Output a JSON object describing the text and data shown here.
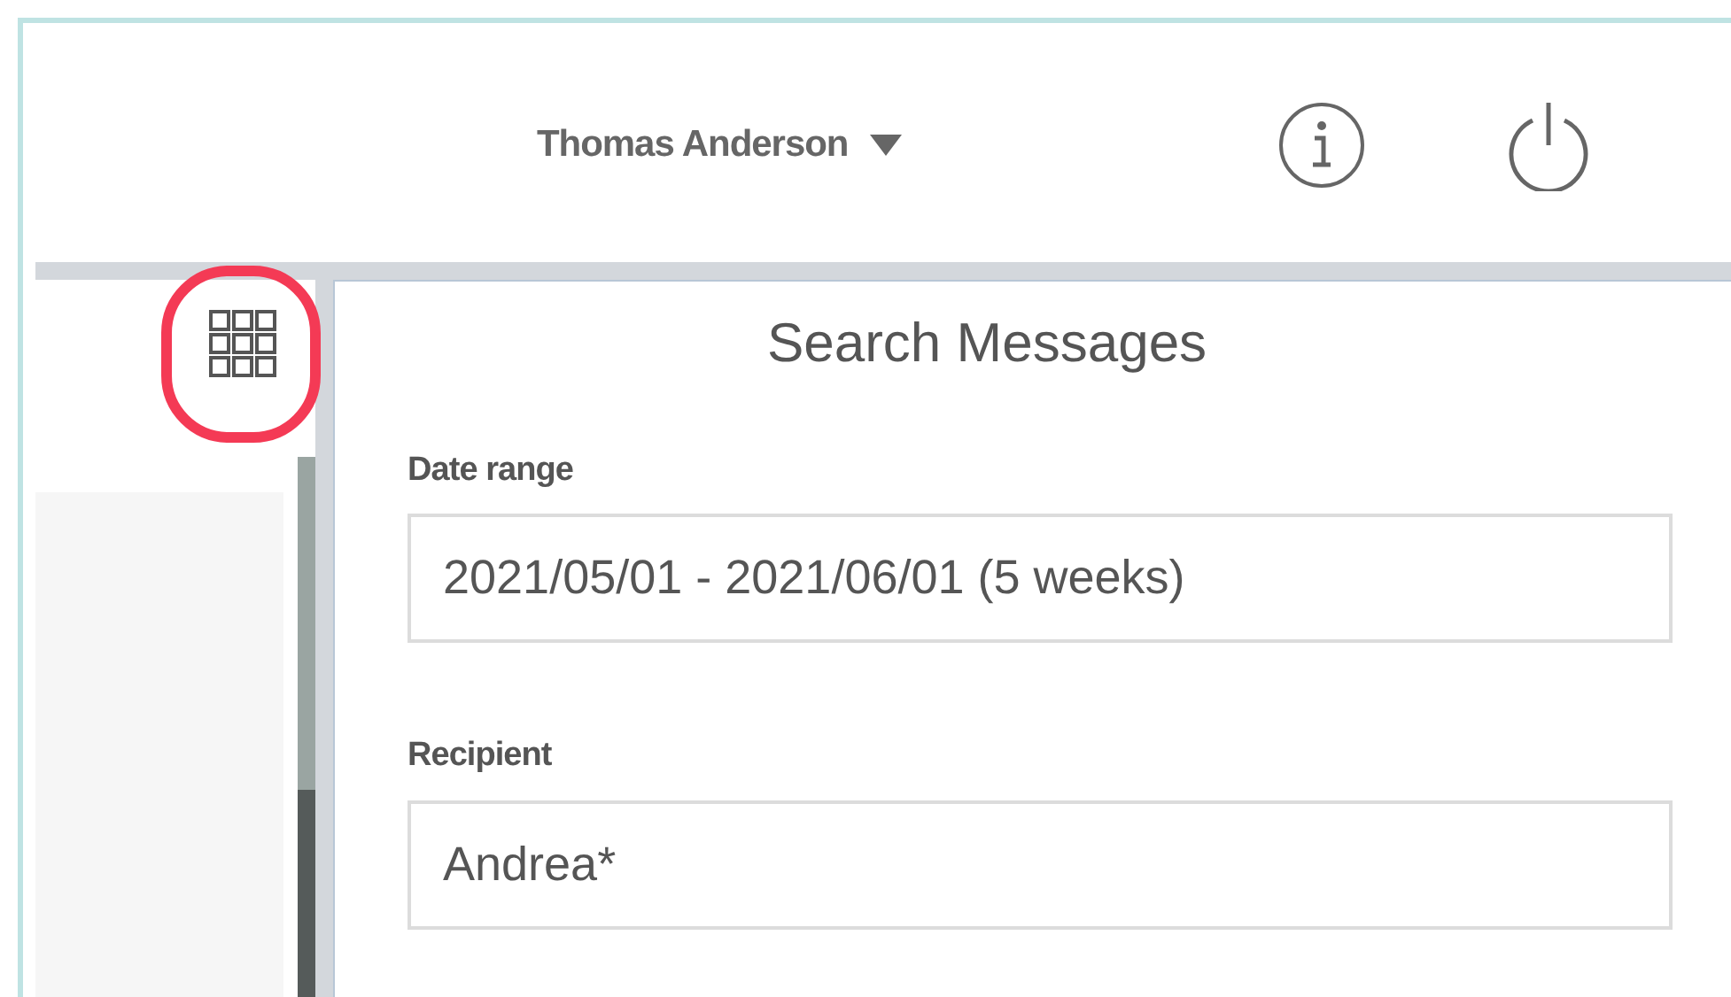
{
  "header": {
    "user_name": "Thomas Anderson"
  },
  "panel": {
    "title": "Search Messages",
    "fields": [
      {
        "label": "Date range",
        "value": "2021/05/01 - 2021/06/01 (5 weeks)"
      },
      {
        "label": "Recipient",
        "value": "Andrea*"
      }
    ]
  }
}
